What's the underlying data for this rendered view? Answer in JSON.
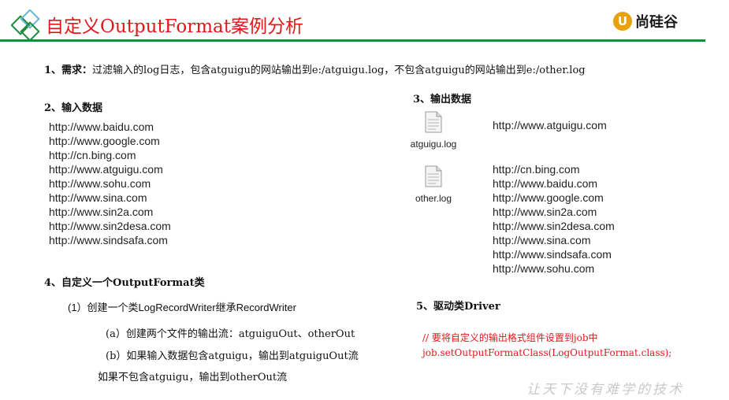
{
  "header": {
    "title": "自定义OutputFormat案例分析",
    "brand_mark": "U",
    "brand_name": "尚硅谷"
  },
  "requirement": {
    "label": "1、需求：",
    "text": "过滤输入的log日志，包含atguigu的网站输出到e:/atguigu.log，不包含atguigu的网站输出到e:/other.log"
  },
  "input": {
    "heading": "2、输入数据",
    "urls": [
      "http://www.baidu.com",
      "http://www.google.com",
      "http://cn.bing.com",
      "http://www.atguigu.com",
      "http://www.sohu.com",
      "http://www.sina.com",
      "http://www.sin2a.com",
      "http://www.sin2desa.com",
      "http://www.sindsafa.com"
    ]
  },
  "output": {
    "heading": "3、输出数据",
    "files": [
      {
        "name": "atguigu.log",
        "urls": [
          "http://www.atguigu.com"
        ]
      },
      {
        "name": "other.log",
        "urls": [
          "http://cn.bing.com",
          "http://www.baidu.com",
          "http://www.google.com",
          "http://www.sin2a.com",
          "http://www.sin2desa.com",
          "http://www.sina.com",
          "http://www.sindsafa.com",
          "http://www.sohu.com"
        ]
      }
    ]
  },
  "custom": {
    "heading": "4、自定义一个OutputFormat类",
    "step1": "(1）创建一个类LogRecordWriter继承RecordWriter",
    "step_a": "(a）创建两个文件的输出流：atguiguOut、otherOut",
    "step_b": "(b）如果输入数据包含atguigu，输出到atguiguOut流",
    "step_b2": "如果不包含atguigu，输出到otherOut流"
  },
  "driver": {
    "heading": "5、驱动类Driver",
    "comment": "//  要将自定义的输出格式组件设置到job中",
    "code": "job.setOutputFormatClass(LogOutputFormat.class);"
  },
  "watermark": "让天下没有难学的技术",
  "colors": {
    "title": "#e3171a",
    "rule": "#1f8a3d",
    "brand": "#e8a20f"
  }
}
